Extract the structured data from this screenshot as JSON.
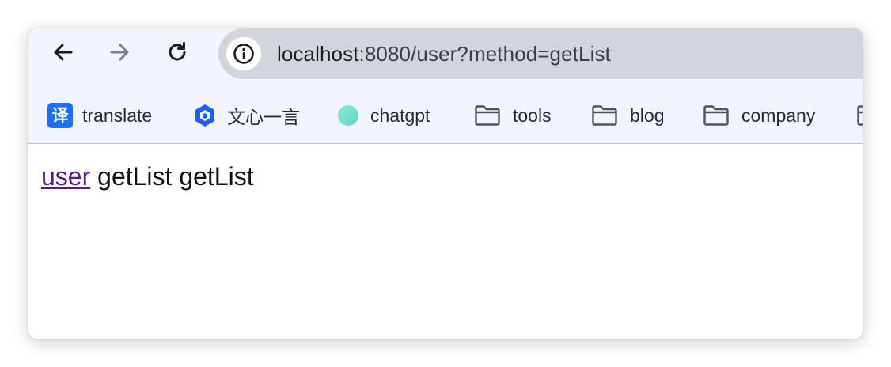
{
  "toolbar": {
    "back_icon": "arrow-left-icon",
    "forward_icon": "arrow-right-icon",
    "reload_icon": "reload-icon"
  },
  "omnibox": {
    "site_info_icon": "info-circle-icon",
    "url_host": "localhost",
    "url_rest": ":8080/user?method=getList"
  },
  "bookmarks": [
    {
      "label": "translate",
      "icon": "translate-icon",
      "glyph": "译"
    },
    {
      "label": "文心一言",
      "icon": "wenxin-logo-icon"
    },
    {
      "label": "chatgpt",
      "icon": "chatgpt-dot-icon"
    },
    {
      "label": "tools",
      "icon": "folder-icon"
    },
    {
      "label": "blog",
      "icon": "folder-icon"
    },
    {
      "label": "company",
      "icon": "folder-icon"
    }
  ],
  "page": {
    "link_text": "user",
    "text_1": "getList",
    "text_2": "getList"
  },
  "colors": {
    "chrome_bg": "#f1f4fa",
    "omnibox_bg": "#d2d5dc",
    "visited_link": "#551a8b",
    "translate_blue": "#1e6ff2",
    "wenxin_blue": "#1d5ef0",
    "chatgpt_teal": "#6fdcc9",
    "folder_stroke": "#4a5566"
  }
}
